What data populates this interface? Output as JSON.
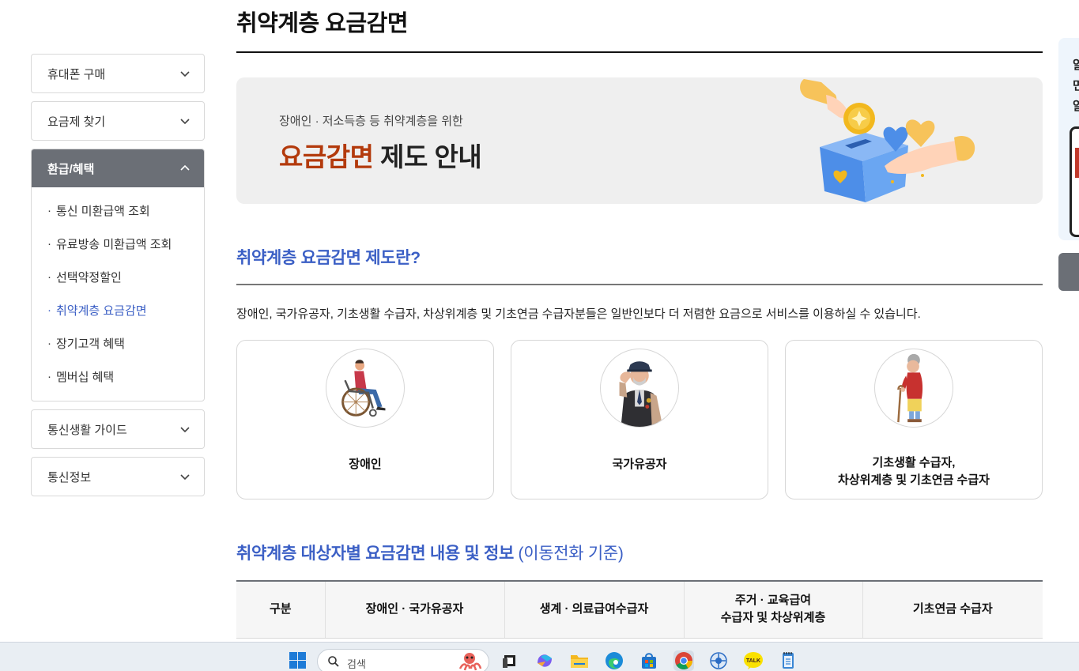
{
  "page": {
    "title": "취약계층 요금감면"
  },
  "sidebar": {
    "menus": [
      {
        "label": "휴대폰 구매",
        "expanded": false
      },
      {
        "label": "요금제 찾기",
        "expanded": false
      },
      {
        "label": "환급/혜택",
        "expanded": true,
        "items": [
          {
            "label": "통신 미환급액 조회"
          },
          {
            "label": "유료방송 미환급액 조회"
          },
          {
            "label": "선택약정할인"
          },
          {
            "label": "취약계층 요금감면",
            "current": true
          },
          {
            "label": "장기고객 혜택"
          },
          {
            "label": "멤버십 혜택"
          }
        ]
      },
      {
        "label": "통신생활 가이드",
        "expanded": false
      },
      {
        "label": "통신정보",
        "expanded": false
      }
    ],
    "bullet": "·"
  },
  "hero": {
    "subtitle": "장애인 · 저소득층 등 취약계층을 위한",
    "title_highlight": "요금감면",
    "title_rest": " 제도 안내",
    "highlight_color": "#b33a0c",
    "art_icon": "donation-box-hands-illustration"
  },
  "section1": {
    "title": "취약계층 요금감면 제도란?",
    "intro": "장애인, 국가유공자, 기초생활 수급자, 차상위계층 및 기초연금 수급자분들은 일반인보다 더 저렴한 요금으로 서비스를 이용하실 수 있습니다."
  },
  "cards": [
    {
      "icon": "wheelchair-person-icon",
      "label_lines": [
        "장애인"
      ]
    },
    {
      "icon": "veteran-saluting-icon",
      "label_lines": [
        "국가유공자"
      ]
    },
    {
      "icon": "elderly-with-cane-icon",
      "label_lines": [
        "기초생활 수급자,",
        "차상위계층 및 기초연금 수급자"
      ]
    }
  ],
  "section2": {
    "title": "취약계층 대상자별 요금감면 내용 및 정보",
    "title_paren": " (이동전화 기준)"
  },
  "table": {
    "headers": [
      [
        "구분"
      ],
      [
        "장애인 · 국가유공자"
      ],
      [
        "생계 · 의료급여수급자"
      ],
      [
        "주거 · 교육급여",
        "수급자 및 차상위계층"
      ],
      [
        "기초연금 수급자"
      ]
    ]
  },
  "right_panel": {
    "text_chars": [
      "알",
      "면",
      "알"
    ]
  },
  "colors": {
    "accent": "#3b5fc5",
    "active_menu_bg": "#6b6f76",
    "highlight": "#b33a0c"
  },
  "taskbar": {
    "search_placeholder": "검색",
    "icons": [
      "windows-start-icon",
      "search-icon",
      "task-view-icon",
      "copilot-icon",
      "file-explorer-icon",
      "edge-browser-icon",
      "store-icon",
      "chrome-browser-icon",
      "network-app-icon",
      "kakaotalk-icon",
      "notepad-icon"
    ],
    "kakao_label": "TALK"
  }
}
